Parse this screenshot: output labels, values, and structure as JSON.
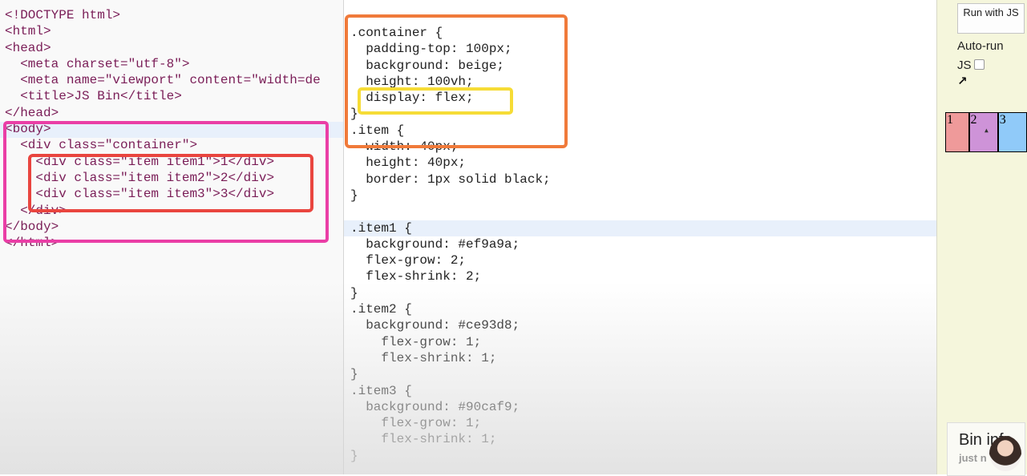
{
  "html_editor": {
    "lines": [
      "<!DOCTYPE html>",
      "<html>",
      "<head>",
      "  <meta charset=\"utf-8\">",
      "  <meta name=\"viewport\" content=\"width=de",
      "  <title>JS Bin</title>",
      "</head>",
      "<body>",
      "  <div class=\"container\">",
      "    <div class=\"item item1\">1</div>",
      "    <div class=\"item item2\">2</div>",
      "    <div class=\"item item3\">3</div>",
      "  </div>",
      "</body>",
      "</html>"
    ]
  },
  "css_editor": {
    "lines": [
      ".container {",
      "  padding-top: 100px;",
      "  background: beige;",
      "  height: 100vh;",
      "  display: flex;",
      "}",
      ".item {",
      "  width: 40px;",
      "  height: 40px;",
      "  border: 1px solid black;",
      "}",
      "",
      ".item1 {",
      "  background: #ef9a9a;",
      "  flex-grow: 2;",
      "  flex-shrink: 2;",
      "}",
      ".item2 {",
      "  background: #ce93d8;",
      "    flex-grow: 1;",
      "    flex-shrink: 1;",
      "}",
      ".item3 {",
      "  background: #90caf9;",
      "    flex-grow: 1;",
      "    flex-shrink: 1;",
      "}"
    ]
  },
  "output": {
    "run_button": "Run with JS",
    "autorun_label": "Auto-run",
    "autorun_js": "JS",
    "arrow_icon": "arrow-up-right-icon",
    "items": [
      "1",
      "2",
      "3"
    ],
    "item_colors": [
      "#ef9a9a",
      "#ce93d8",
      "#90caf9"
    ]
  },
  "bin_info": {
    "title": "Bin info",
    "subtitle": "just n"
  },
  "annotation_colors": {
    "body_box": "#ea3ea6",
    "items_box": "#e9453f",
    "container_box": "#f07a3a",
    "display_box": "#f6dc36"
  }
}
